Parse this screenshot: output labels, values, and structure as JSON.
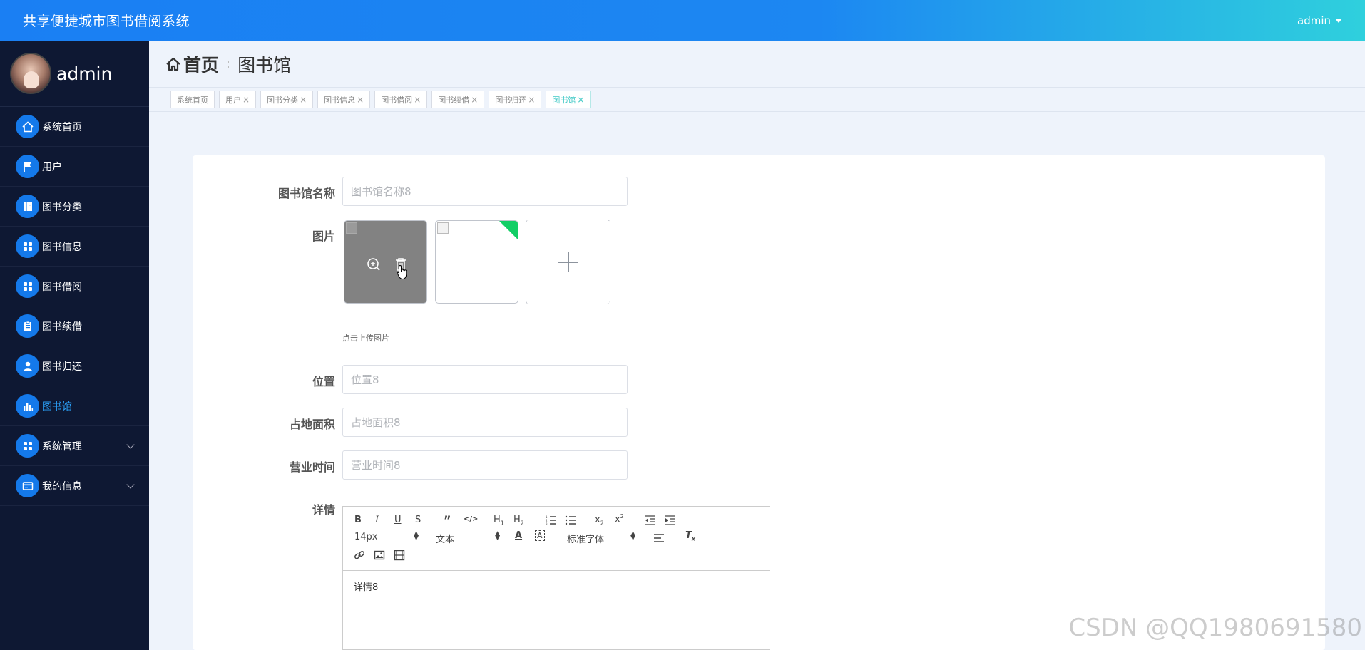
{
  "header": {
    "title": "共享便捷城市图书借阅系统",
    "user": "admin"
  },
  "sidebar": {
    "profile_name": "admin",
    "items": [
      {
        "label": "系统首页",
        "icon": "home-icon"
      },
      {
        "label": "用户",
        "icon": "flag-icon"
      },
      {
        "label": "图书分类",
        "icon": "book-icon"
      },
      {
        "label": "图书信息",
        "icon": "grid-icon"
      },
      {
        "label": "图书借阅",
        "icon": "grid-icon"
      },
      {
        "label": "图书续借",
        "icon": "clipboard-icon"
      },
      {
        "label": "图书归还",
        "icon": "person-icon"
      },
      {
        "label": "图书馆",
        "icon": "bar-chart-icon",
        "active": true
      },
      {
        "label": "系统管理",
        "icon": "grid-icon",
        "expandable": true
      },
      {
        "label": "我的信息",
        "icon": "card-icon",
        "expandable": true
      }
    ]
  },
  "breadcrumb": {
    "home": "首页",
    "separator": ":",
    "current": "图书馆"
  },
  "tags": [
    {
      "label": "系统首页",
      "closable": false
    },
    {
      "label": "用户",
      "closable": true
    },
    {
      "label": "图书分类",
      "closable": true
    },
    {
      "label": "图书信息",
      "closable": true
    },
    {
      "label": "图书借阅",
      "closable": true
    },
    {
      "label": "图书续借",
      "closable": true
    },
    {
      "label": "图书归还",
      "closable": true
    },
    {
      "label": "图书馆",
      "closable": true,
      "active": true
    }
  ],
  "form": {
    "name": {
      "label": "图书馆名称",
      "placeholder": "图书馆名称8"
    },
    "picture": {
      "label": "图片",
      "hint": "点击上传图片"
    },
    "location": {
      "label": "位置",
      "placeholder": "位置8"
    },
    "area": {
      "label": "占地面积",
      "placeholder": "占地面积8"
    },
    "hours": {
      "label": "营业时间",
      "placeholder": "营业时间8"
    },
    "detail": {
      "label": "详情",
      "content": "详情8",
      "size_picker": "14px",
      "header_picker": "文本",
      "font_picker": "标准字体"
    }
  },
  "colors": {
    "accent": "#1479ea",
    "active_menu": "#2a9ef5",
    "active_tag": "#40c9c6",
    "success_corner": "#13ce66"
  },
  "watermark": "CSDN @QQ1980691580"
}
